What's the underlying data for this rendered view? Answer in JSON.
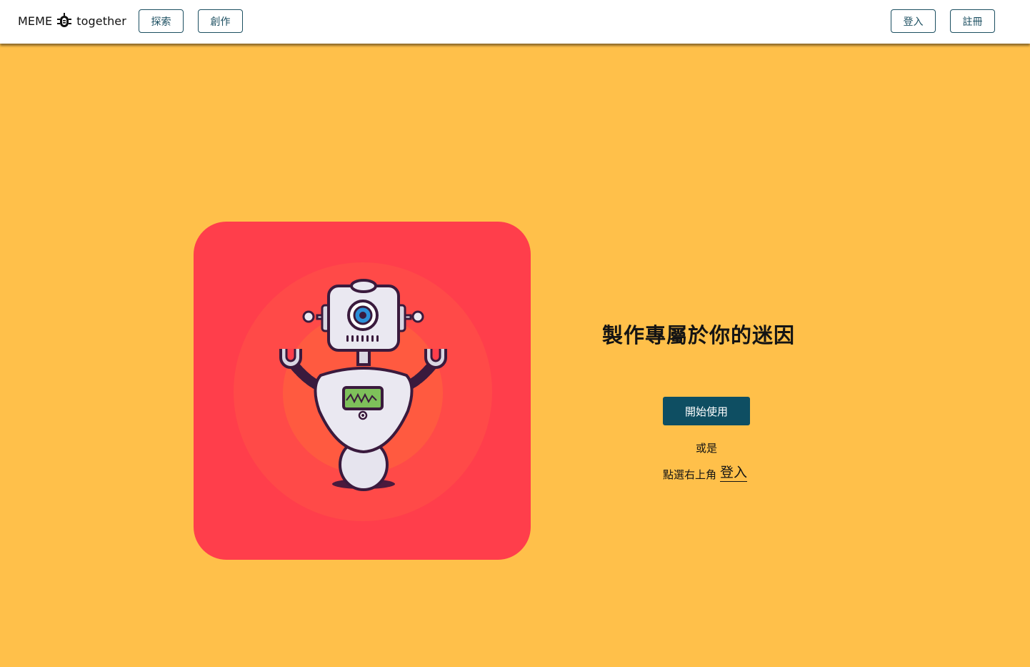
{
  "header": {
    "brand_prefix": "MEME",
    "brand_suffix": "together",
    "nav": {
      "explore_label": "探索",
      "create_label": "創作"
    },
    "auth": {
      "login_label": "登入",
      "register_label": "註冊"
    }
  },
  "hero": {
    "headline": "製作專屬於你的迷因",
    "cta_label": "開始使用",
    "or_text": "或是",
    "hint_prefix": "點選右上角",
    "hint_link": "登入"
  },
  "colors": {
    "background": "#FFC04A",
    "card": "#FF3E4B",
    "primary": "#0E4E62",
    "nav_border": "#1c4f61"
  },
  "icons": {
    "brand": "bug-robot-icon",
    "illustration": "robot-illustration"
  }
}
